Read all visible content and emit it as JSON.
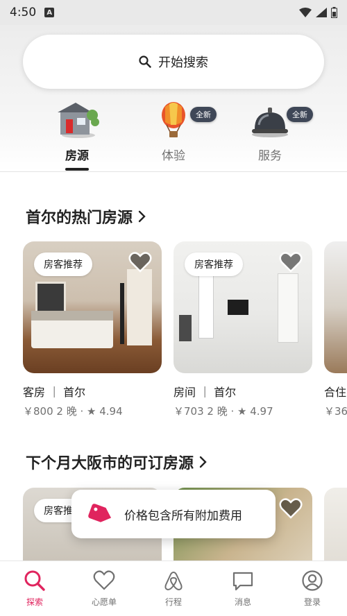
{
  "status_bar": {
    "time": "4:50",
    "a_badge": "A"
  },
  "search": {
    "label": "开始搜索"
  },
  "categories": [
    {
      "label": "房源",
      "active": true
    },
    {
      "label": "体验",
      "badge": "全新"
    },
    {
      "label": "服务",
      "badge": "全新"
    }
  ],
  "sections": [
    {
      "title": "首尔的热门房源",
      "cards": [
        {
          "pill": "房客推荐",
          "title": "客房 ｜ 首尔",
          "meta": "￥800 2 晚 · ★ 4.94"
        },
        {
          "pill": "房客推荐",
          "title": "房间 ｜ 首尔",
          "meta": "￥703 2 晚 · ★ 4.97"
        },
        {
          "pill": "",
          "title": "合住",
          "meta": "￥36"
        }
      ]
    },
    {
      "title": "下个月大阪市的可订房源",
      "cards": [
        {
          "pill": "房客推荐"
        },
        {
          "pill": ""
        },
        {
          "pill": ""
        }
      ]
    }
  ],
  "toast": {
    "text": "价格包含所有附加费用"
  },
  "nav": [
    {
      "label": "探索",
      "active": true
    },
    {
      "label": "心愿单"
    },
    {
      "label": "行程"
    },
    {
      "label": "消息"
    },
    {
      "label": "登录"
    }
  ],
  "colors": {
    "accent": "#e0245e",
    "badge_bg": "#3f4757",
    "text": "#222222",
    "muted": "#717171"
  }
}
